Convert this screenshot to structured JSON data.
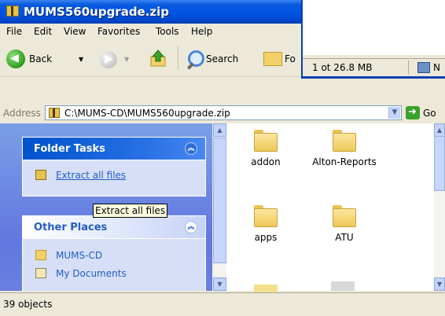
{
  "window": {
    "title": "MUMS560upgrade.zip"
  },
  "overlay_window": {
    "status_size": "1 ot 26.8 MB",
    "status_right": "N"
  },
  "menu": [
    "File",
    "Edit",
    "View",
    "Favorites",
    "Tools",
    "Help"
  ],
  "toolbar": {
    "back_label": "Back",
    "search_label": "Search",
    "folders_label": "Fo"
  },
  "address": {
    "label": "Address",
    "value": "C:\\MUMS-CD\\MUMS560upgrade.zip",
    "go_label": "Go"
  },
  "folder_tasks": {
    "title": "Folder Tasks",
    "items": [
      {
        "label": "Extract all files"
      }
    ]
  },
  "tooltip": "Extract all files",
  "other_places": {
    "title": "Other Places",
    "items": [
      {
        "label": "MUMS-CD"
      },
      {
        "label": "My Documents"
      }
    ]
  },
  "files": [
    {
      "name": "addon"
    },
    {
      "name": "Alton-Reports"
    },
    {
      "name": "apps"
    },
    {
      "name": "ATU"
    }
  ],
  "status": {
    "count": "39 objects"
  }
}
